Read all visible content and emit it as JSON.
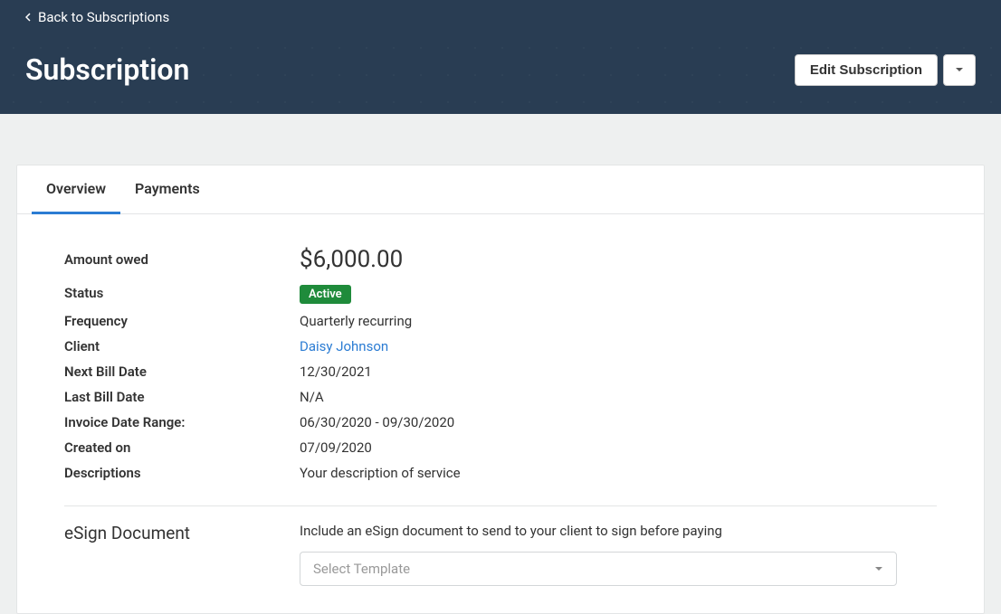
{
  "header": {
    "back_label": "Back to Subscriptions",
    "page_title": "Subscription",
    "edit_button": "Edit Subscription"
  },
  "tabs": {
    "overview": "Overview",
    "payments": "Payments"
  },
  "overview": {
    "amount_label": "Amount owed",
    "amount_value": "$6,000.00",
    "status_label": "Status",
    "status_value": "Active",
    "frequency_label": "Frequency",
    "frequency_value": "Quarterly recurring",
    "client_label": "Client",
    "client_value": "Daisy Johnson",
    "next_bill_label": "Next Bill Date",
    "next_bill_value": "12/30/2021",
    "last_bill_label": "Last Bill Date",
    "last_bill_value": "N/A",
    "invoice_range_label": "Invoice Date Range:",
    "invoice_range_value": "06/30/2020 - 09/30/2020",
    "created_label": "Created on",
    "created_value": "07/09/2020",
    "descriptions_label": "Descriptions",
    "descriptions_value": "Your description of service"
  },
  "esign": {
    "title": "eSign Document",
    "description": "Include an eSign document to send to your client to sign before paying",
    "select_placeholder": "Select Template"
  }
}
